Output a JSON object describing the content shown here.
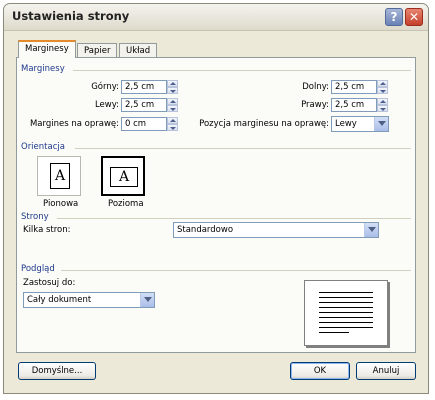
{
  "window": {
    "title": "Ustawienia strony"
  },
  "tabs": [
    {
      "label": "Marginesy"
    },
    {
      "label": "Papier"
    },
    {
      "label": "Układ"
    }
  ],
  "margins": {
    "section_label": "Marginesy",
    "top_label": "Górny:",
    "top_value": "2,5 cm",
    "bottom_label": "Dolny:",
    "bottom_value": "2,5 cm",
    "left_label": "Lewy:",
    "left_value": "2,5 cm",
    "right_label": "Prawy:",
    "right_value": "2,5 cm",
    "gutter_label": "Margines na oprawę:",
    "gutter_value": "0 cm",
    "gutter_pos_label": "Pozycja marginesu na oprawę:",
    "gutter_pos_value": "Lewy"
  },
  "orientation": {
    "section_label": "Orientacja",
    "portrait_label": "Pionowa",
    "landscape_label": "Pozioma",
    "page_glyph": "A",
    "selected": "landscape"
  },
  "pages": {
    "section_label": "Strony",
    "multiple_label": "Kilka stron:",
    "multiple_value": "Standardowo"
  },
  "preview": {
    "section_label": "Podgląd",
    "apply_label": "Zastosuj do:",
    "apply_value": "Cały dokument"
  },
  "buttons": {
    "default": "Domyślne...",
    "ok": "OK",
    "cancel": "Anuluj"
  },
  "icons": {
    "help": "?",
    "close": "✕"
  }
}
